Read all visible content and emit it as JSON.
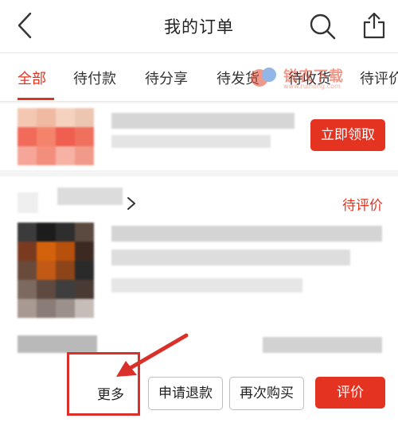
{
  "header": {
    "title": "我的订单",
    "back_icon": "chevron-left-icon",
    "search_icon": "search-icon",
    "share_icon": "share-icon"
  },
  "tabs": [
    {
      "label": "全部",
      "active": true
    },
    {
      "label": "待付款",
      "active": false
    },
    {
      "label": "待分享",
      "active": false
    },
    {
      "label": "待发货",
      "active": false
    },
    {
      "label": "待收货",
      "active": false
    },
    {
      "label": "待评价",
      "active": false
    }
  ],
  "watermark": {
    "text": "锐农下载",
    "sub": "www.ruinong.com"
  },
  "promo": {
    "claim_label": "立即领取"
  },
  "order": {
    "status": "待评价",
    "actions": {
      "more": "更多",
      "refund": "申请退款",
      "rebuy": "再次购买",
      "review": "评价"
    }
  },
  "colors": {
    "accent": "#e0331e",
    "button_red": "#e53322"
  }
}
